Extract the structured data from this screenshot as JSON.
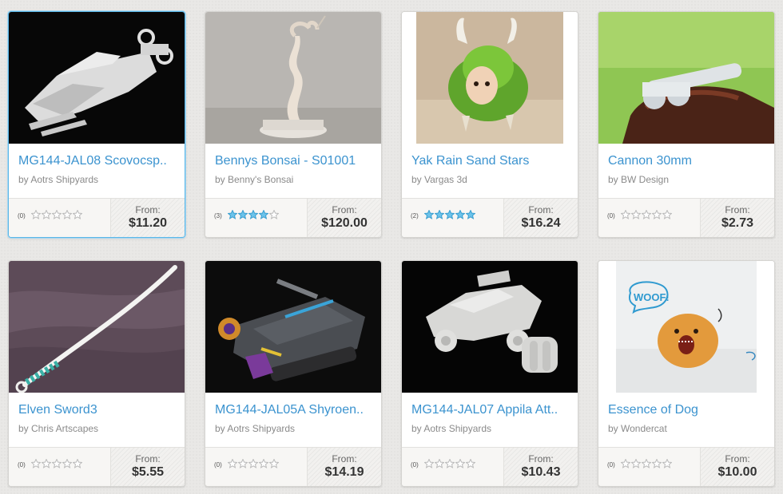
{
  "colors": {
    "title_link": "#3b93cf",
    "star_empty": "#b9b9b9",
    "star_filled": "#6cc3ea",
    "selected_border": "#5bb6e6"
  },
  "products": [
    {
      "title": "MG144-JAL08 Scovocsp..",
      "author": "by Aotrs Shipyards",
      "review_count": "(0)",
      "rating": 0,
      "from_label": "From:",
      "price": "$11.20",
      "image": "white-spaceship-model"
    },
    {
      "title": "Bennys Bonsai - S01001",
      "author": "by Benny's Bonsai",
      "review_count": "(3)",
      "rating": 4,
      "from_label": "From:",
      "price": "$120.00",
      "image": "white-bonsai-sculpture"
    },
    {
      "title": "Yak Rain Sand Stars",
      "author": "by Vargas 3d",
      "review_count": "(2)",
      "rating": 5,
      "from_label": "From:",
      "price": "$16.24",
      "image": "green-yak-figure"
    },
    {
      "title": "Cannon 30mm",
      "author": "by BW Design",
      "review_count": "(0)",
      "rating": 0,
      "from_label": "From:",
      "price": "$2.73",
      "image": "clear-cannon-model"
    },
    {
      "title": "Elven Sword3",
      "author": "by Chris Artscapes",
      "review_count": "(0)",
      "rating": 0,
      "from_label": "From:",
      "price": "$5.55",
      "image": "white-curved-sword"
    },
    {
      "title": "MG144-JAL05A Shyroen..",
      "author": "by Aotrs Shipyards",
      "review_count": "(0)",
      "rating": 0,
      "from_label": "From:",
      "price": "$14.19",
      "image": "painted-tank-model"
    },
    {
      "title": "MG144-JAL07 Appila Att..",
      "author": "by Aotrs Shipyards",
      "review_count": "(0)",
      "rating": 0,
      "from_label": "From:",
      "price": "$10.43",
      "image": "white-vehicle-model"
    },
    {
      "title": "Essence of Dog",
      "author": "by Wondercat",
      "review_count": "(0)",
      "rating": 0,
      "from_label": "From:",
      "price": "$10.00",
      "image": "orange-dog-figure"
    }
  ],
  "thumb_labels": {
    "woof": "WOOF!"
  }
}
